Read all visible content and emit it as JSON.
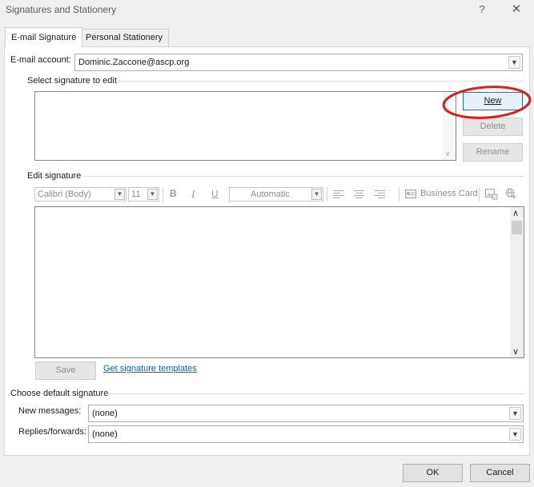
{
  "window": {
    "title": "Signatures and Stationery",
    "help": "?",
    "close": "✕"
  },
  "tabs": [
    {
      "label": "E-mail Signature"
    },
    {
      "label": "Personal Stationery"
    }
  ],
  "email_account": {
    "label": "E-mail account:",
    "value": "Dominic.Zaccone@ascp.org"
  },
  "select_signature": {
    "label": "Select signature to edit"
  },
  "sig_buttons": {
    "new": "New",
    "delete": "Delete",
    "rename": "Rename"
  },
  "edit_signature": {
    "label": "Edit signature"
  },
  "toolbar": {
    "font": "Calibri (Body)",
    "size": "11",
    "bold": "B",
    "italic": "I",
    "underline": "U",
    "color": "Automatic",
    "business_card": "Business Card"
  },
  "save_label": "Save",
  "templates_link": "Get signature templates",
  "defaults": {
    "label": "Choose default signature",
    "new_messages_label": "New messages:",
    "new_messages_value": "(none)",
    "replies_label": "Replies/forwards:",
    "replies_value": "(none)"
  },
  "footer": {
    "ok": "OK",
    "cancel": "Cancel"
  },
  "annotation_color": "#d62020"
}
